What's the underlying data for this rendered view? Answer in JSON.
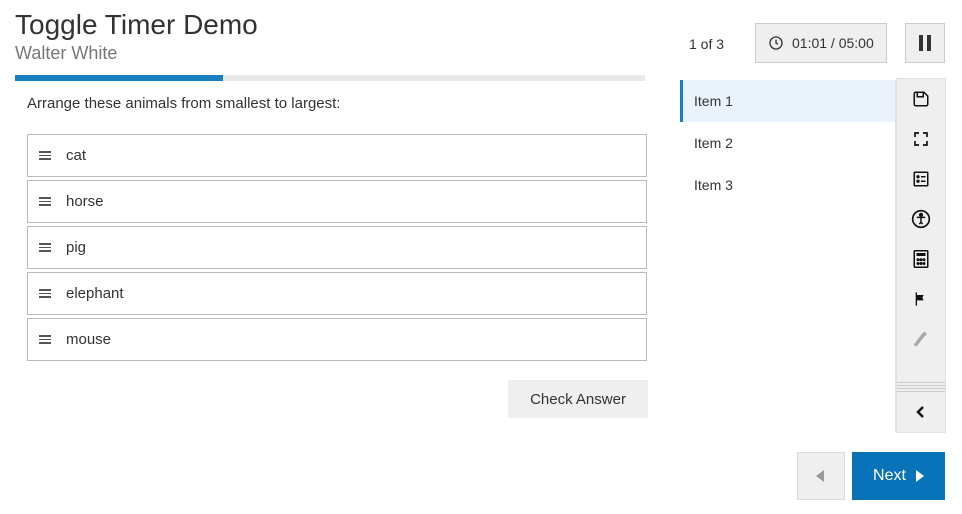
{
  "header": {
    "title": "Toggle Timer Demo",
    "author": "Walter White"
  },
  "counter": "1 of 3",
  "timer": "01:01 / 05:00",
  "progress_pct": 33,
  "question": {
    "prompt": "Arrange these animals from smallest to largest:",
    "options": [
      "cat",
      "horse",
      "pig",
      "elephant",
      "mouse"
    ]
  },
  "check_label": "Check Answer",
  "items_nav": [
    {
      "label": "Item 1",
      "active": true
    },
    {
      "label": "Item 2",
      "active": false
    },
    {
      "label": "Item 3",
      "active": false
    }
  ],
  "toolbar": {
    "save": "save-icon",
    "fullscreen": "fullscreen-icon",
    "review": "review-icon",
    "accessibility": "accessibility-icon",
    "calculator": "calculator-icon",
    "flag": "flag-icon",
    "line_reader": "line-reader-icon",
    "collapse": "chevron-left-icon"
  },
  "footer": {
    "prev": "previous",
    "next": "Next"
  }
}
